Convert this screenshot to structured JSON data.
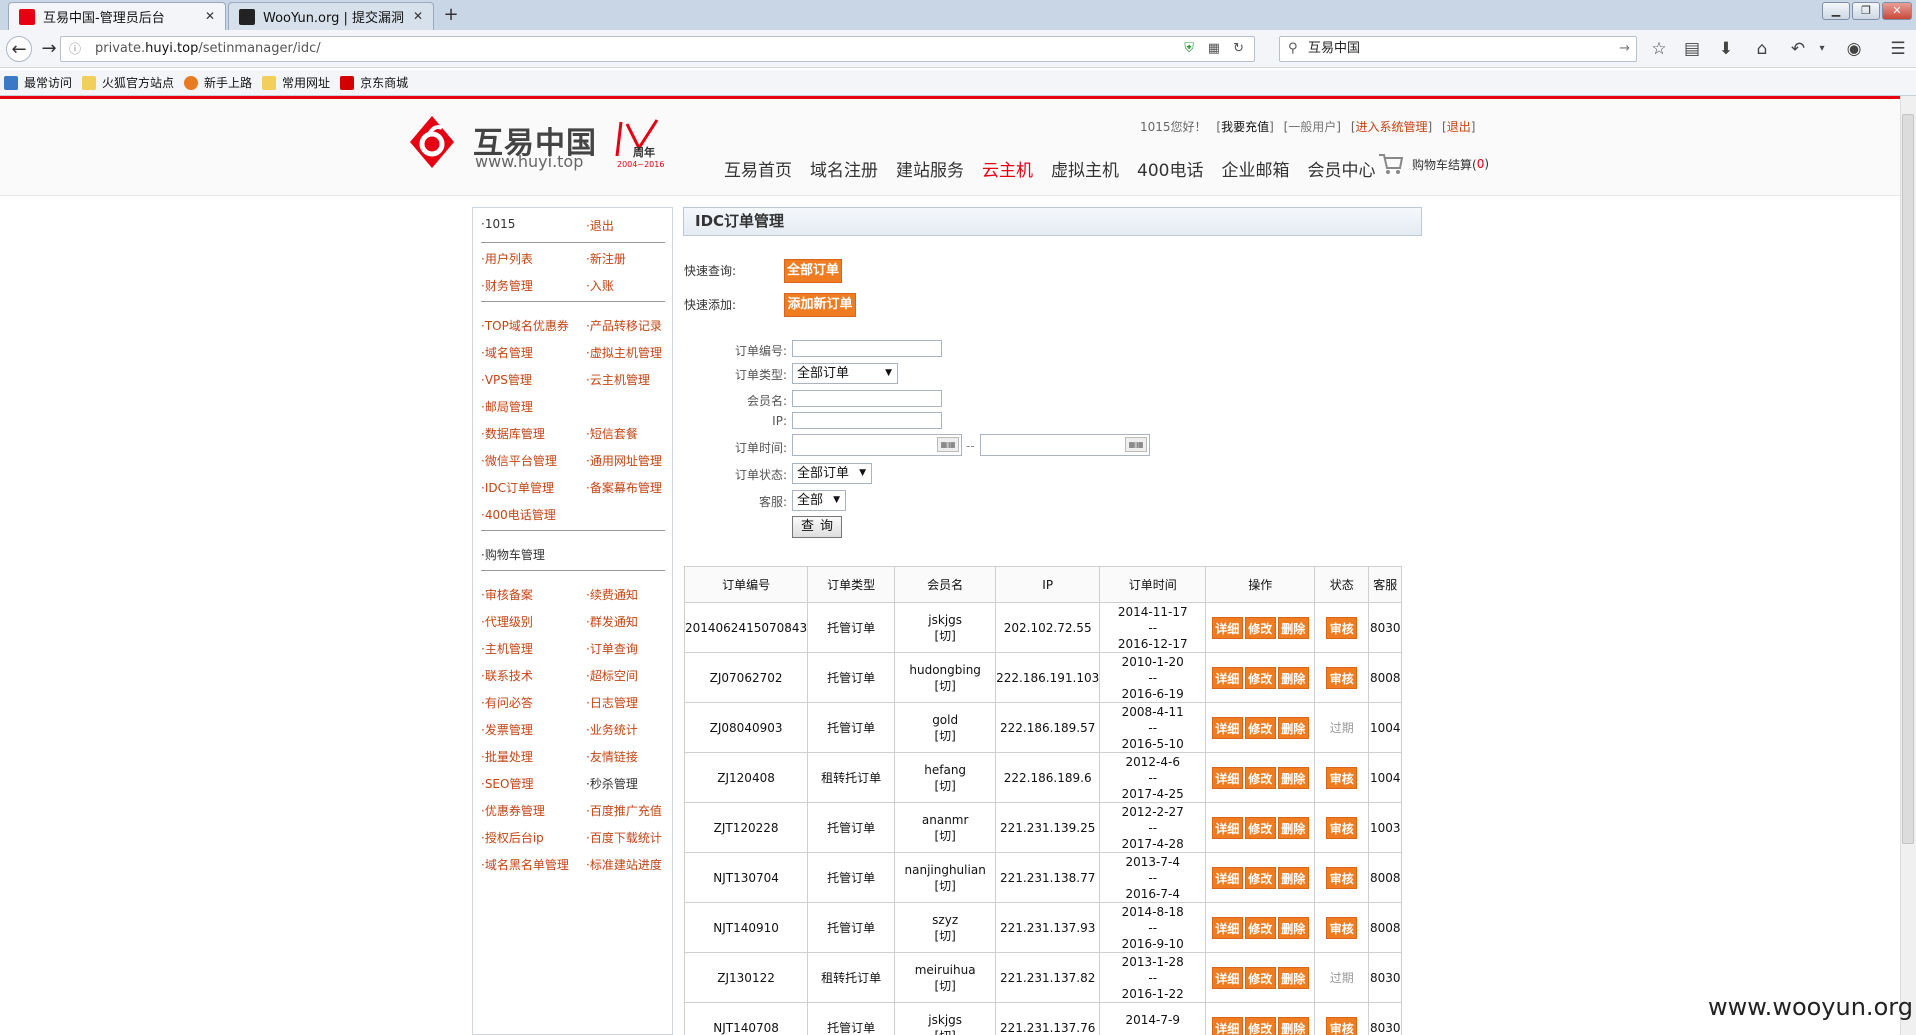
{
  "browser": {
    "tabs": [
      {
        "title": "互易中国-管理员后台",
        "active": true
      },
      {
        "title": "WooYun.org | 提交漏洞",
        "active": false
      }
    ],
    "url_prefix": "private.",
    "url_host": "huyi.top",
    "url_path": "/setinmanager/idc/",
    "search_value": "互易中国",
    "bookmarks": [
      "最常访问",
      "火狐官方站点",
      "新手上路",
      "常用网址",
      "京东商城"
    ]
  },
  "header": {
    "logo_text": "互易中国",
    "logo_url": "www.huyi.top",
    "anniv_label": "周年",
    "anniv_years": "2004~2016",
    "greeting": "1015您好！",
    "links": [
      "我要充值",
      "一般用户",
      "进入系统管理",
      "退出"
    ],
    "nav": [
      "互易首页",
      "域名注册",
      "建站服务",
      "云主机",
      "虚拟主机",
      "400电话",
      "企业邮箱",
      "会员中心"
    ],
    "nav_active_index": 3,
    "cart_label": "购物车结算(",
    "cart_count": "0",
    "cart_close": ")"
  },
  "sidebar": {
    "user": "·1015",
    "logout": "·退出",
    "groups": [
      [
        [
          "·用户列表",
          "·新注册"
        ],
        [
          "·财务管理",
          "·入账"
        ]
      ],
      [
        [
          "·TOP域名优惠券",
          "·产品转移记录"
        ],
        [
          "·域名管理",
          "·虚拟主机管理"
        ],
        [
          "·VPS管理",
          "·云主机管理"
        ],
        [
          "·邮局管理",
          ""
        ],
        [
          "·数据库管理",
          "·短信套餐"
        ],
        [
          "·微信平台管理",
          "·通用网址管理"
        ],
        [
          "·IDC订单管理",
          "·备案幕布管理"
        ],
        [
          "·400电话管理",
          ""
        ]
      ],
      [
        [
          "·购物车管理",
          ""
        ]
      ],
      [
        [
          "·审核备案",
          "·续费通知"
        ],
        [
          "·代理级别",
          "·群发通知"
        ],
        [
          "·主机管理",
          "·订单查询"
        ],
        [
          "·联系技术",
          "·超标空间"
        ],
        [
          "·有问必答",
          "·日志管理"
        ],
        [
          "·发票管理",
          "·业务统计"
        ],
        [
          "·批量处理",
          "·友情链接"
        ],
        [
          "·SEO管理",
          "·秒杀管理"
        ],
        [
          "·优惠券管理",
          "·百度推广充值"
        ],
        [
          "·授权后台ip",
          "·百度下载统计"
        ],
        [
          "·域名黑名单管理",
          "·标准建站进度"
        ]
      ]
    ]
  },
  "main": {
    "title": "IDC订单管理",
    "quick_query_label": "快速查询:",
    "quick_query_button": "全部订单",
    "quick_add_label": "快速添加:",
    "quick_add_button": "添加新订单",
    "form": {
      "order_no_label": "订单编号:",
      "order_type_label": "订单类型:",
      "order_type_value": "全部订单",
      "member_label": "会员名:",
      "ip_label": "IP:",
      "time_label": "订单时间:",
      "time_sep": "--",
      "status_label": "订单状态:",
      "status_value": "全部订单",
      "service_label": "客服:",
      "service_value": "全部",
      "query_button": "查询"
    },
    "table": {
      "headers": [
        "订单编号",
        "订单类型",
        "会员名",
        "IP",
        "订单时间",
        "操作",
        "状态",
        "客服"
      ],
      "actions": [
        "详细",
        "修改",
        "删除"
      ],
      "switch_label": "[切]",
      "date_sep": "--",
      "rows": [
        {
          "no": "2014062415070843",
          "type": "托管订单",
          "member": "jskjgs",
          "ip": "202.102.72.55",
          "start": "2014-11-17",
          "end": "2016-12-17",
          "status": "审核",
          "status_expired": false,
          "service": "8030"
        },
        {
          "no": "ZJ07062702",
          "type": "托管订单",
          "member": "hudongbing",
          "ip": "222.186.191.103",
          "start": "2010-1-20",
          "end": "2016-6-19",
          "status": "审核",
          "status_expired": false,
          "service": "8008"
        },
        {
          "no": "ZJ08040903",
          "type": "托管订单",
          "member": "gold",
          "ip": "222.186.189.57",
          "start": "2008-4-11",
          "end": "2016-5-10",
          "status": "过期",
          "status_expired": true,
          "service": "1004"
        },
        {
          "no": "ZJ120408",
          "type": "租转托订单",
          "member": "hefang",
          "ip": "222.186.189.6",
          "start": "2012-4-6",
          "end": "2017-4-25",
          "status": "审核",
          "status_expired": false,
          "service": "1004"
        },
        {
          "no": "ZJT120228",
          "type": "托管订单",
          "member": "ananmr",
          "ip": "221.231.139.25",
          "start": "2012-2-27",
          "end": "2017-4-28",
          "status": "审核",
          "status_expired": false,
          "service": "1003"
        },
        {
          "no": "NJT130704",
          "type": "托管订单",
          "member": "nanjinghulian",
          "ip": "221.231.138.77",
          "start": "2013-7-4",
          "end": "2016-7-4",
          "status": "审核",
          "status_expired": false,
          "service": "8008"
        },
        {
          "no": "NJT140910",
          "type": "托管订单",
          "member": "szyz",
          "ip": "221.231.137.93",
          "start": "2014-8-18",
          "end": "2016-9-10",
          "status": "审核",
          "status_expired": false,
          "service": "8008"
        },
        {
          "no": "ZJ130122",
          "type": "租转托订单",
          "member": "meiruihua",
          "ip": "221.231.137.82",
          "start": "2013-1-28",
          "end": "2016-1-22",
          "status": "过期",
          "status_expired": true,
          "service": "8030"
        },
        {
          "no": "NJT140708",
          "type": "托管订单",
          "member": "jskjgs",
          "ip": "221.231.137.76",
          "start": "2014-7-9",
          "end": "",
          "status": "审核",
          "status_expired": false,
          "service": "8030"
        }
      ]
    }
  },
  "watermark": "www.wooyun.org",
  "colors": {
    "brand_red": "#e60012",
    "action_orange": "#f07c22",
    "menu_link": "#c44414"
  }
}
